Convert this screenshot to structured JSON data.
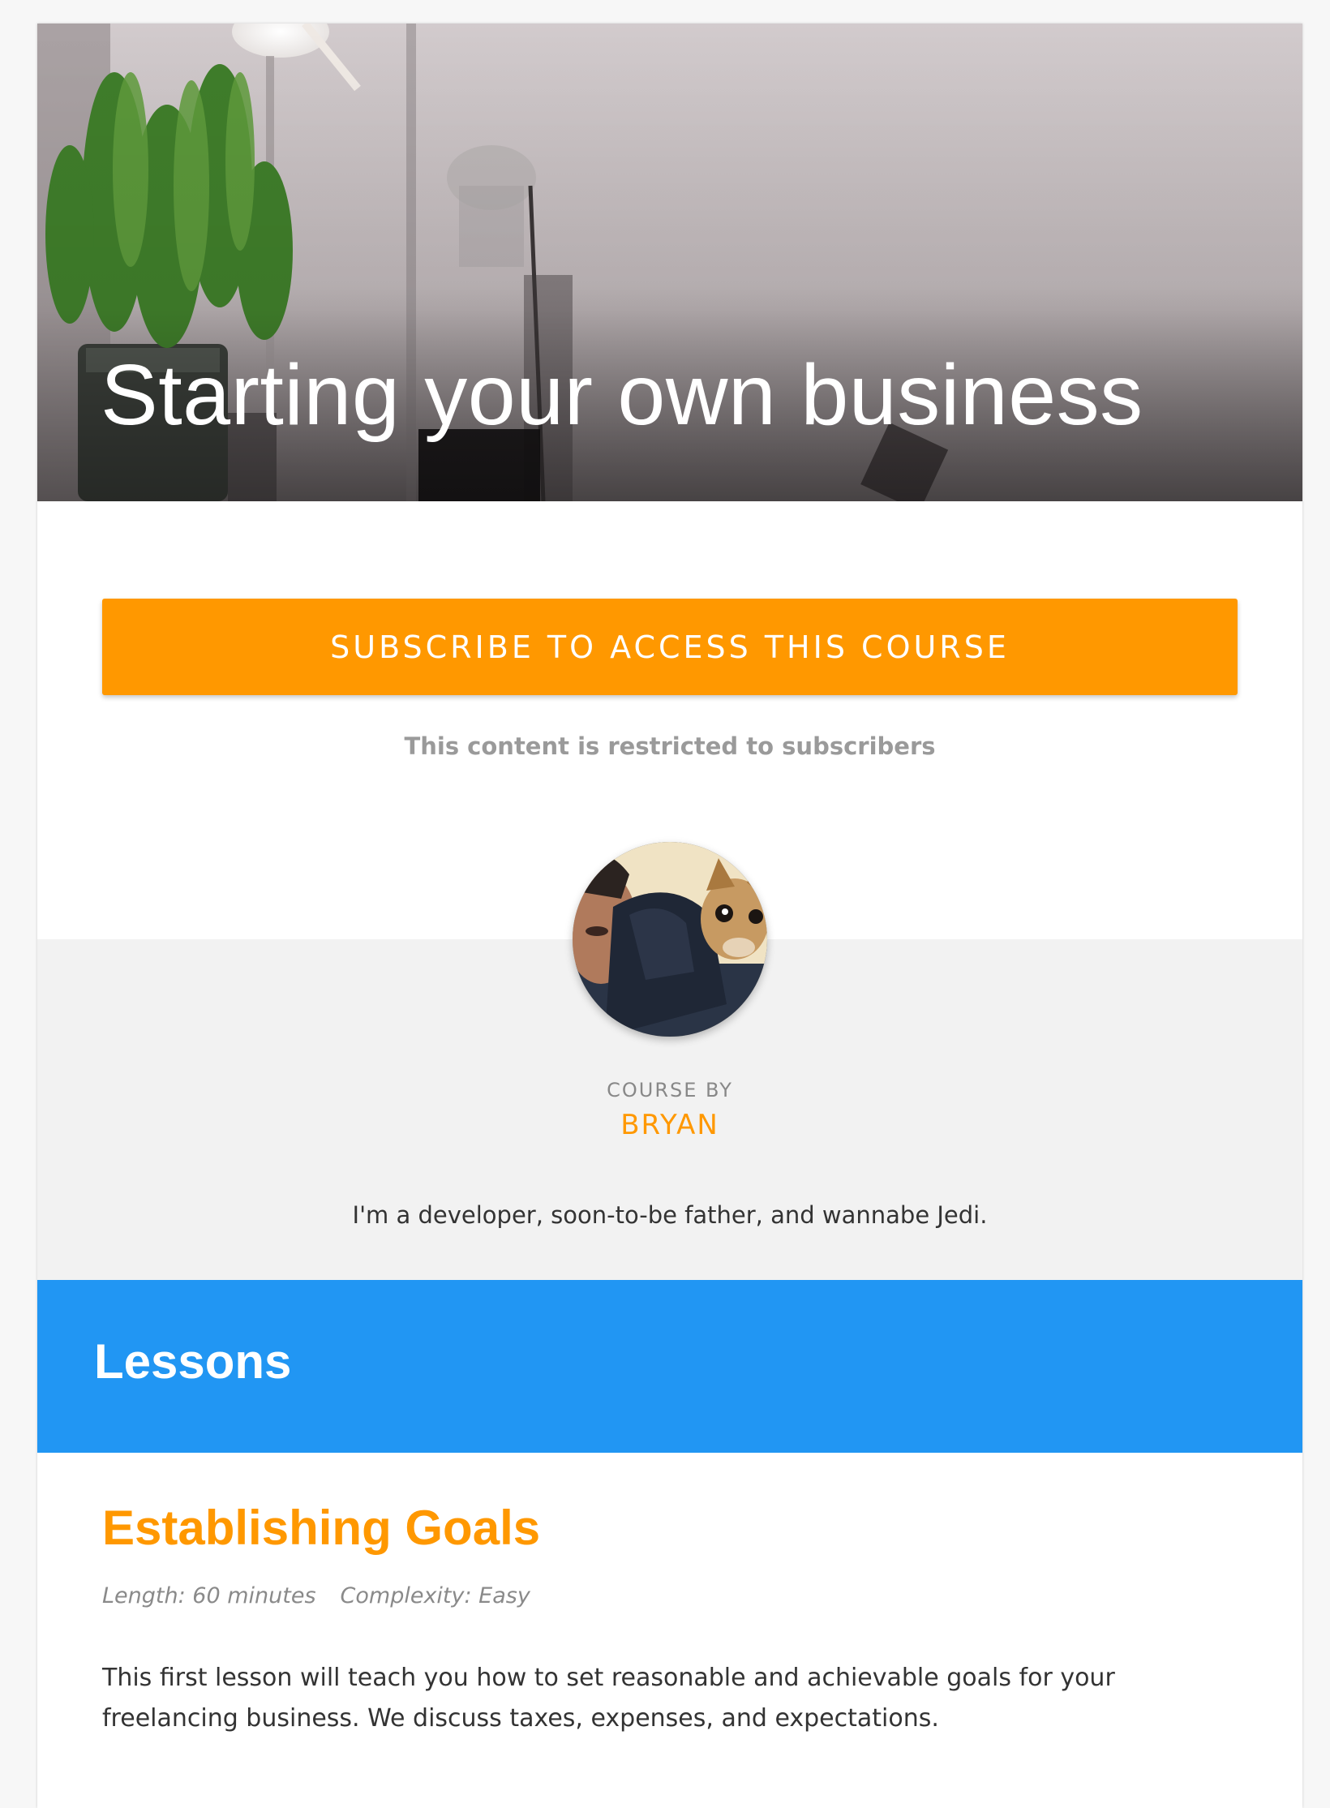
{
  "course": {
    "title": "Starting your own business"
  },
  "subscribe": {
    "button_label": "SUBSCRIBE TO ACCESS THIS COURSE",
    "restricted_note": "This content is restricted to subscribers"
  },
  "author": {
    "label": "COURSE BY",
    "name": "BRYAN",
    "bio": "I'm a developer, soon-to-be father, and wannabe Jedi."
  },
  "lessons": {
    "heading": "Lessons",
    "items": [
      {
        "title": "Establishing Goals",
        "length": "Length: 60 minutes",
        "complexity": "Complexity: Easy",
        "description": "This first lesson will teach you how to set reasonable and achievable goals for your freelancing business. We discuss taxes, expenses, and expectations."
      }
    ]
  },
  "colors": {
    "accent": "#ff9800",
    "lessons_banner": "#2196f3",
    "author_background": "#f2f2f2"
  }
}
